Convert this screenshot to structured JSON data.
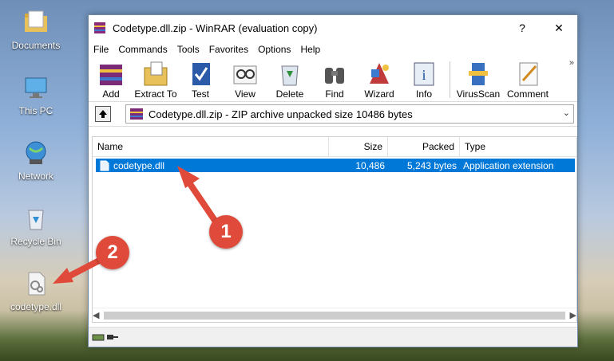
{
  "desktop": {
    "icons": [
      {
        "label": "Documents"
      },
      {
        "label": "This PC"
      },
      {
        "label": "Network"
      },
      {
        "label": "Recycle Bin"
      },
      {
        "label": "codetype.dll"
      }
    ]
  },
  "window": {
    "title": "Codetype.dll.zip - WinRAR (evaluation copy)",
    "help_btn": "?",
    "close_btn": "✕"
  },
  "menu": [
    "File",
    "Commands",
    "Tools",
    "Favorites",
    "Options",
    "Help"
  ],
  "toolbar": {
    "buttons": [
      "Add",
      "Extract To",
      "Test",
      "View",
      "Delete",
      "Find",
      "Wizard",
      "Info",
      "VirusScan",
      "Comment"
    ],
    "more": "»"
  },
  "address": {
    "text": "Codetype.dll.zip - ZIP archive unpacked size 10486 bytes"
  },
  "columns": [
    "Name",
    "Size",
    "Packed",
    "Type"
  ],
  "files": [
    {
      "name": "codetype.dll",
      "size": "10,486",
      "packed": "5,243 bytes",
      "type": "Application extension"
    }
  ],
  "annotations": [
    "1",
    "2"
  ],
  "colors": {
    "selection": "#0078d7",
    "annotation": "#e04a3a"
  }
}
